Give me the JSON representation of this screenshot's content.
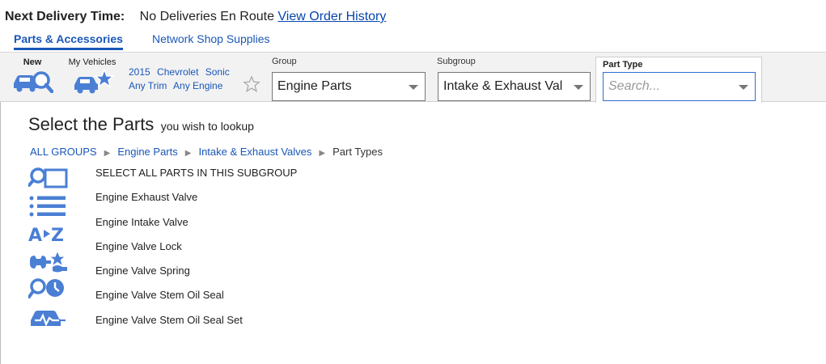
{
  "header": {
    "delivery_label": "Next Delivery Time:",
    "delivery_value": "No Deliveries En Route",
    "history_link": "View Order History"
  },
  "tabs": [
    {
      "label": "Parts & Accessories",
      "active": true
    },
    {
      "label": "Network Shop Supplies",
      "active": false
    }
  ],
  "toolbar": {
    "new_label": "New",
    "my_vehicles_label": "My Vehicles",
    "vehicle": {
      "year": "2015",
      "make": "Chevrolet",
      "model": "Sonic",
      "trim": "Any Trim",
      "engine": "Any Engine"
    },
    "group": {
      "label": "Group",
      "value": "Engine Parts"
    },
    "subgroup": {
      "label": "Subgroup",
      "value": "Intake & Exhaust Val"
    },
    "part_type": {
      "label": "Part Type",
      "placeholder": "Search..."
    }
  },
  "main": {
    "title": "Select the Parts",
    "subtitle": "you wish to lookup",
    "breadcrumbs": [
      "ALL GROUPS",
      "Engine Parts",
      "Intake & Exhaust Valves"
    ],
    "breadcrumb_current": "Part Types",
    "parts": [
      "SELECT ALL PARTS IN THIS SUBGROUP",
      "Engine Exhaust Valve",
      "Engine Intake Valve",
      "Engine Valve Lock",
      "Engine Valve Spring",
      "Engine Valve Stem Oil Seal",
      "Engine Valve Stem Oil Seal Set"
    ]
  },
  "colors": {
    "accent": "#1a57b8",
    "icon": "#4a7fd4",
    "toolbar_bg": "#f2f2f2"
  },
  "icons": [
    "search-catalog-icon",
    "list-icon",
    "a-to-z-icon",
    "tools-icon",
    "search-history-icon",
    "vehicle-diagnostics-icon"
  ]
}
